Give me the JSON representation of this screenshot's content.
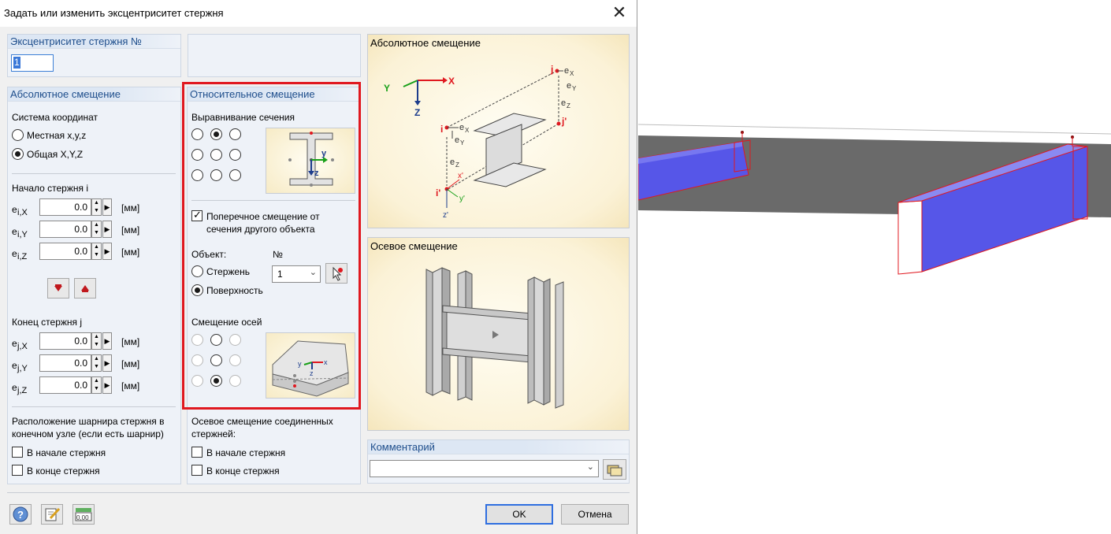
{
  "dialog": {
    "title": "Задать или изменить эксцентриситет стержня",
    "close_label": "✕",
    "ecc_no": {
      "heading": "Эксцентриситет стержня №",
      "value": "1"
    },
    "absolute": {
      "heading": "Абсолютное смещение",
      "coord_system_label": "Система координат",
      "coord_local": "Местная x,y,z",
      "coord_global": "Общая X,Y,Z",
      "start_label": "Начало стержня  i",
      "start": [
        {
          "sym": "e",
          "sub": "i,X",
          "value": "0.0",
          "unit": "[мм]"
        },
        {
          "sym": "e",
          "sub": "i,Y",
          "value": "0.0",
          "unit": "[мм]"
        },
        {
          "sym": "e",
          "sub": "i,Z",
          "value": "0.0",
          "unit": "[мм]"
        }
      ],
      "end_label": "Конец стержня j",
      "end": [
        {
          "sym": "e",
          "sub": "j,X",
          "value": "0.0",
          "unit": "[мм]"
        },
        {
          "sym": "e",
          "sub": "j,Y",
          "value": "0.0",
          "unit": "[мм]"
        },
        {
          "sym": "e",
          "sub": "j,Z",
          "value": "0.0",
          "unit": "[мм]"
        }
      ],
      "hinge_label": "Расположение шарнира стержня в конечном узле (если есть шарнир)",
      "hinge_start": "В начале стержня",
      "hinge_end": "В конце стержня"
    },
    "relative": {
      "heading": "Относительное смещение",
      "section_align_label": "Выравнивание сечения",
      "transverse_label": "Поперечное смещение от сечения другого объекта",
      "object_label": "Объект:",
      "no_label": "№",
      "object_member": "Стержень",
      "object_surface": "Поверхность",
      "object_no": "1",
      "axis_offset_label": "Смещение осей",
      "axial_label": "Осевое смещение соединенных стержней:",
      "axial_start": "В начале стержня",
      "axial_end": "В конце стержня"
    },
    "images": {
      "absolute_title": "Абсолютное смещение",
      "axial_title": "Осевое смещение"
    },
    "comment": {
      "heading": "Комментарий",
      "value": ""
    },
    "buttons": {
      "ok": "OK",
      "cancel": "Отмена"
    }
  },
  "colors": {
    "highlight": "#e0181f",
    "accent": "#1e4e8c",
    "member": "#5656e8"
  }
}
